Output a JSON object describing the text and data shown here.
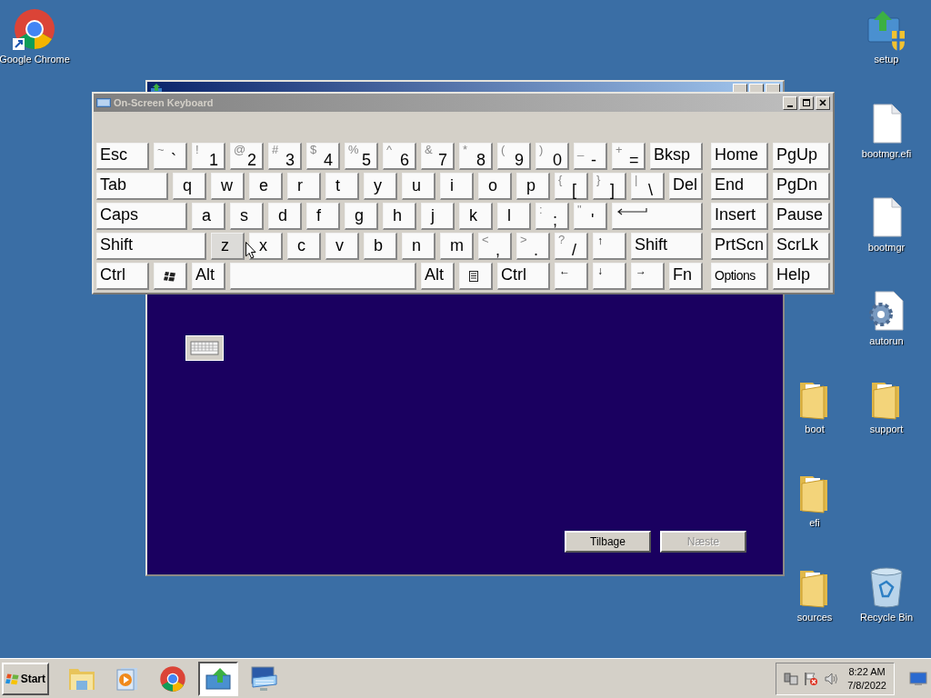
{
  "desktop_icons": [
    {
      "label": "Google Chrome",
      "kind": "chrome"
    },
    {
      "label": "setup",
      "kind": "setup"
    },
    {
      "label": "bootmgr.efi",
      "kind": "file"
    },
    {
      "label": "bootmgr",
      "kind": "file"
    },
    {
      "label": "autorun",
      "kind": "settings-file"
    },
    {
      "label": "support",
      "kind": "folder"
    },
    {
      "label": "boot",
      "kind": "folder"
    },
    {
      "label": "efi",
      "kind": "folder"
    },
    {
      "label": "sources",
      "kind": "folder"
    },
    {
      "label": "Recycle Bin",
      "kind": "recycle"
    }
  ],
  "installer": {
    "buttons": [
      {
        "label": "Tilbage",
        "disabled": false
      },
      {
        "label": "Næste",
        "disabled": true
      }
    ]
  },
  "keyboard": {
    "title": "On-Screen Keyboard",
    "rows": [
      {
        "keys": [
          {
            "kind": "label",
            "main": "Esc",
            "hovered": false
          },
          {
            "kind": "dual",
            "shift": "~",
            "main": "`",
            "hovered": false
          },
          {
            "kind": "dual",
            "shift": "!",
            "main": "1",
            "hovered": false
          },
          {
            "kind": "dual",
            "shift": "@",
            "main": "2",
            "hovered": false
          },
          {
            "kind": "dual",
            "shift": "#",
            "main": "3",
            "hovered": false
          },
          {
            "kind": "dual",
            "shift": "$",
            "main": "4",
            "hovered": false
          },
          {
            "kind": "dual",
            "shift": "%",
            "main": "5",
            "hovered": false
          },
          {
            "kind": "dual",
            "shift": "^",
            "main": "6",
            "hovered": false
          },
          {
            "kind": "dual",
            "shift": "&",
            "main": "7",
            "hovered": false
          },
          {
            "kind": "dual",
            "shift": "*",
            "main": "8",
            "hovered": false
          },
          {
            "kind": "dual",
            "shift": "(",
            "main": "9",
            "hovered": false
          },
          {
            "kind": "dual",
            "shift": ")",
            "main": "0",
            "hovered": false
          },
          {
            "kind": "dual",
            "shift": "_",
            "main": "-",
            "hovered": false
          },
          {
            "kind": "dual",
            "shift": "+",
            "main": "=",
            "hovered": false
          },
          {
            "kind": "label",
            "main": "Bksp",
            "hovered": false
          }
        ]
      },
      {
        "keys": [
          {
            "kind": "label",
            "main": "Tab",
            "hovered": false
          },
          {
            "kind": "letter",
            "main": "q",
            "hovered": false
          },
          {
            "kind": "letter",
            "main": "w",
            "hovered": false
          },
          {
            "kind": "letter",
            "main": "e",
            "hovered": false
          },
          {
            "kind": "letter",
            "main": "r",
            "hovered": false
          },
          {
            "kind": "letter",
            "main": "t",
            "hovered": false
          },
          {
            "kind": "letter",
            "main": "y",
            "hovered": false
          },
          {
            "kind": "letter",
            "main": "u",
            "hovered": false
          },
          {
            "kind": "letter",
            "main": "i",
            "hovered": false
          },
          {
            "kind": "letter",
            "main": "o",
            "hovered": false
          },
          {
            "kind": "letter",
            "main": "p",
            "hovered": false
          },
          {
            "kind": "dual",
            "shift": "{",
            "main": "[",
            "hovered": false
          },
          {
            "kind": "dual",
            "shift": "}",
            "main": "]",
            "hovered": false
          },
          {
            "kind": "dual",
            "shift": "|",
            "main": "\\",
            "hovered": false
          },
          {
            "kind": "label",
            "main": "Del",
            "hovered": false
          }
        ]
      },
      {
        "keys": [
          {
            "kind": "label",
            "main": "Caps",
            "hovered": false
          },
          {
            "kind": "letter",
            "main": "a",
            "hovered": false
          },
          {
            "kind": "letter",
            "main": "s",
            "hovered": false
          },
          {
            "kind": "letter",
            "main": "d",
            "hovered": false
          },
          {
            "kind": "letter",
            "main": "f",
            "hovered": false
          },
          {
            "kind": "letter",
            "main": "g",
            "hovered": false
          },
          {
            "kind": "letter",
            "main": "h",
            "hovered": false
          },
          {
            "kind": "letter",
            "main": "j",
            "hovered": false
          },
          {
            "kind": "letter",
            "main": "k",
            "hovered": false
          },
          {
            "kind": "letter",
            "main": "l",
            "hovered": false
          },
          {
            "kind": "dual",
            "shift": ":",
            "main": ";",
            "hovered": false
          },
          {
            "kind": "dual",
            "shift": "\"",
            "main": "'",
            "hovered": false
          },
          {
            "kind": "enter",
            "hovered": false
          }
        ]
      },
      {
        "keys": [
          {
            "kind": "label",
            "main": "Shift",
            "hovered": false
          },
          {
            "kind": "letter",
            "main": "z",
            "hovered": true
          },
          {
            "kind": "letter",
            "main": "x",
            "hovered": false
          },
          {
            "kind": "letter",
            "main": "c",
            "hovered": false
          },
          {
            "kind": "letter",
            "main": "v",
            "hovered": false
          },
          {
            "kind": "letter",
            "main": "b",
            "hovered": false
          },
          {
            "kind": "letter",
            "main": "n",
            "hovered": false
          },
          {
            "kind": "letter",
            "main": "m",
            "hovered": false
          },
          {
            "kind": "dual",
            "shift": "<",
            "main": ",",
            "hovered": false
          },
          {
            "kind": "dual",
            "shift": ">",
            "main": ".",
            "hovered": false
          },
          {
            "kind": "dual",
            "shift": "?",
            "main": "/",
            "hovered": false
          },
          {
            "kind": "arrow",
            "main": "↑",
            "hovered": false
          },
          {
            "kind": "label",
            "main": "Shift",
            "hovered": false
          }
        ]
      },
      {
        "keys": [
          {
            "kind": "label",
            "main": "Ctrl",
            "hovered": false
          },
          {
            "kind": "windows",
            "hovered": false
          },
          {
            "kind": "label",
            "main": "Alt",
            "hovered": false
          },
          {
            "kind": "space",
            "hovered": false
          },
          {
            "kind": "label",
            "main": "Alt",
            "hovered": false
          },
          {
            "kind": "menu",
            "hovered": false
          },
          {
            "kind": "label",
            "main": "Ctrl",
            "hovered": false
          },
          {
            "kind": "arrow",
            "main": "←",
            "hovered": false
          },
          {
            "kind": "arrow",
            "main": "↓",
            "hovered": false
          },
          {
            "kind": "arrow",
            "main": "→",
            "hovered": false
          },
          {
            "kind": "label",
            "main": "Fn",
            "hovered": false
          }
        ]
      }
    ],
    "nav_rows": [
      [
        {
          "kind": "label",
          "main": "Home"
        },
        {
          "kind": "label",
          "main": "PgUp"
        }
      ],
      [
        {
          "kind": "label",
          "main": "End"
        },
        {
          "kind": "label",
          "main": "PgDn"
        }
      ],
      [
        {
          "kind": "label",
          "main": "Insert"
        },
        {
          "kind": "label",
          "main": "Pause"
        }
      ],
      [
        {
          "kind": "label",
          "main": "PrtScn"
        },
        {
          "kind": "label",
          "main": "ScrLk"
        }
      ],
      [
        {
          "kind": "small",
          "main": "Options"
        },
        {
          "kind": "label",
          "main": "Help"
        }
      ]
    ]
  },
  "taskbar": {
    "start": "Start",
    "items": [
      {
        "kind": "explorer",
        "selected": false
      },
      {
        "kind": "media",
        "selected": false
      },
      {
        "kind": "chrome",
        "selected": false
      },
      {
        "kind": "setup",
        "selected": true
      },
      {
        "kind": "keyboard",
        "selected": false
      }
    ],
    "tray": {
      "time": "8:22 AM",
      "date": "7/8/2022"
    }
  }
}
